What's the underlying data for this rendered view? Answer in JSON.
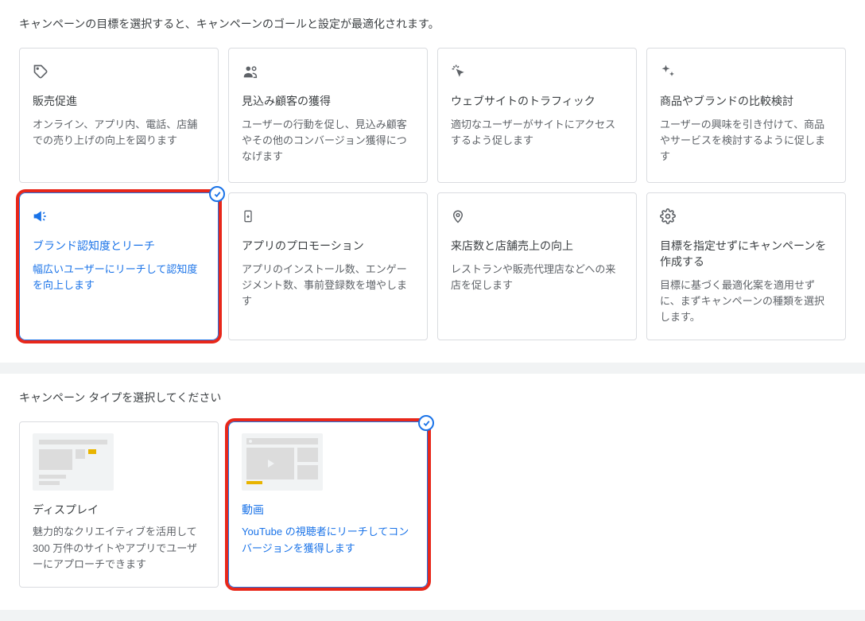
{
  "objectives": {
    "header": "キャンペーンの目標を選択すると、キャンペーンのゴールと設定が最適化されます。",
    "cards": [
      {
        "title": "販売促進",
        "desc": "オンライン、アプリ内、電話、店舗での売り上げの向上を図ります"
      },
      {
        "title": "見込み顧客の獲得",
        "desc": "ユーザーの行動を促し、見込み顧客やその他のコンバージョン獲得につなげます"
      },
      {
        "title": "ウェブサイトのトラフィック",
        "desc": "適切なユーザーがサイトにアクセスするよう促します"
      },
      {
        "title": "商品やブランドの比較検討",
        "desc": "ユーザーの興味を引き付けて、商品やサービスを検討するように促します"
      },
      {
        "title": "ブランド認知度とリーチ",
        "desc": "幅広いユーザーにリーチして認知度を向上します"
      },
      {
        "title": "アプリのプロモーション",
        "desc": "アプリのインストール数、エンゲージメント数、事前登録数を増やします"
      },
      {
        "title": "来店数と店舗売上の向上",
        "desc": "レストランや販売代理店などへの来店を促します"
      },
      {
        "title": "目標を指定せずにキャンペーンを作成する",
        "desc": "目標に基づく最適化案を適用せずに、まずキャンペーンの種類を選択します。"
      }
    ]
  },
  "types": {
    "header": "キャンペーン タイプを選択してください",
    "cards": [
      {
        "title": "ディスプレイ",
        "desc": "魅力的なクリエイティブを活用して 300 万件のサイトやアプリでユーザーにアプローチできます"
      },
      {
        "title": "動画",
        "desc": "YouTube の視聴者にリーチしてコンバージョンを獲得します"
      }
    ]
  }
}
